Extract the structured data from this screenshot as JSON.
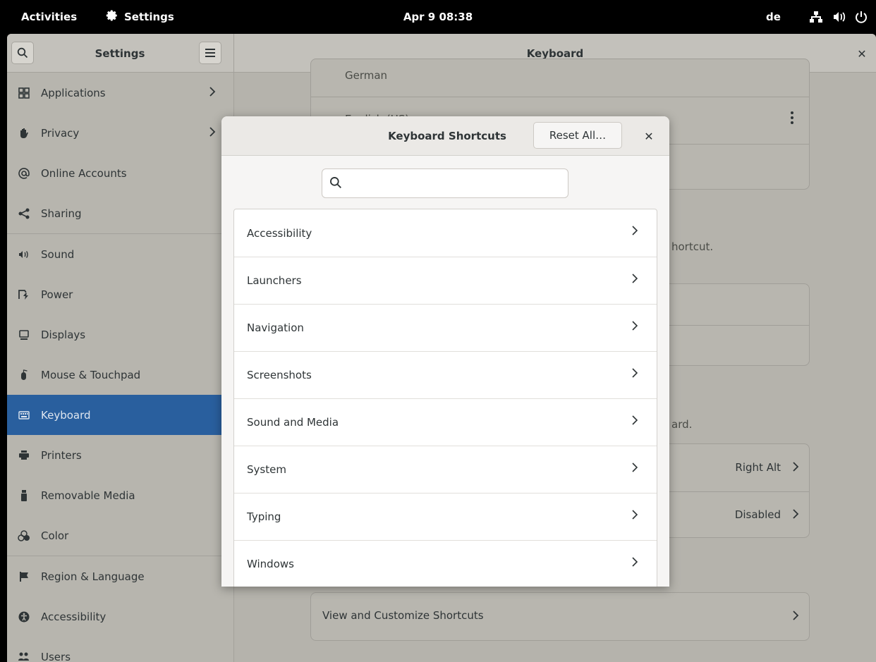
{
  "topbar": {
    "activities": "Activities",
    "app_name": "Settings",
    "clock": "Apr 9  08:38",
    "input_source": "de"
  },
  "headerbar": {
    "sidebar_title": "Settings",
    "page_title": "Keyboard"
  },
  "sidebar": {
    "items": [
      {
        "label": "Applications",
        "icon": "applications-grid-icon",
        "has_arrow": true
      },
      {
        "label": "Privacy",
        "icon": "hand-icon",
        "has_arrow": true
      },
      {
        "label": "Online Accounts",
        "icon": "at-sign-icon"
      },
      {
        "label": "Sharing",
        "icon": "share-icon"
      },
      {
        "label": "Sound",
        "icon": "speaker-icon"
      },
      {
        "label": "Power",
        "icon": "power-battery-icon"
      },
      {
        "label": "Displays",
        "icon": "display-icon"
      },
      {
        "label": "Mouse & Touchpad",
        "icon": "mouse-icon"
      },
      {
        "label": "Keyboard",
        "icon": "keyboard-icon",
        "selected": true
      },
      {
        "label": "Printers",
        "icon": "printer-icon"
      },
      {
        "label": "Removable Media",
        "icon": "usb-drive-icon"
      },
      {
        "label": "Color",
        "icon": "color-icon"
      },
      {
        "label": "Region & Language",
        "icon": "flag-icon"
      },
      {
        "label": "Accessibility",
        "icon": "accessibility-icon"
      },
      {
        "label": "Users",
        "icon": "users-icon"
      }
    ]
  },
  "main": {
    "input_sources": [
      "German",
      "English (US)"
    ],
    "shortcut_hint_fragment": "hortcut.",
    "key_hint_fragment": "ard.",
    "compose_value": "Right Alt",
    "alternate_value": "Disabled",
    "view_shortcuts_label": "View and Customize Shortcuts"
  },
  "dialog": {
    "title": "Keyboard Shortcuts",
    "reset_label": "Reset All…",
    "search_placeholder": "",
    "categories": [
      "Accessibility",
      "Launchers",
      "Navigation",
      "Screenshots",
      "Sound and Media",
      "System",
      "Typing",
      "Windows"
    ]
  },
  "colors": {
    "selected_bg": "#295f9e",
    "dim_bg": "#b5b3ac",
    "dialog_bg": "#f6f5f4"
  }
}
